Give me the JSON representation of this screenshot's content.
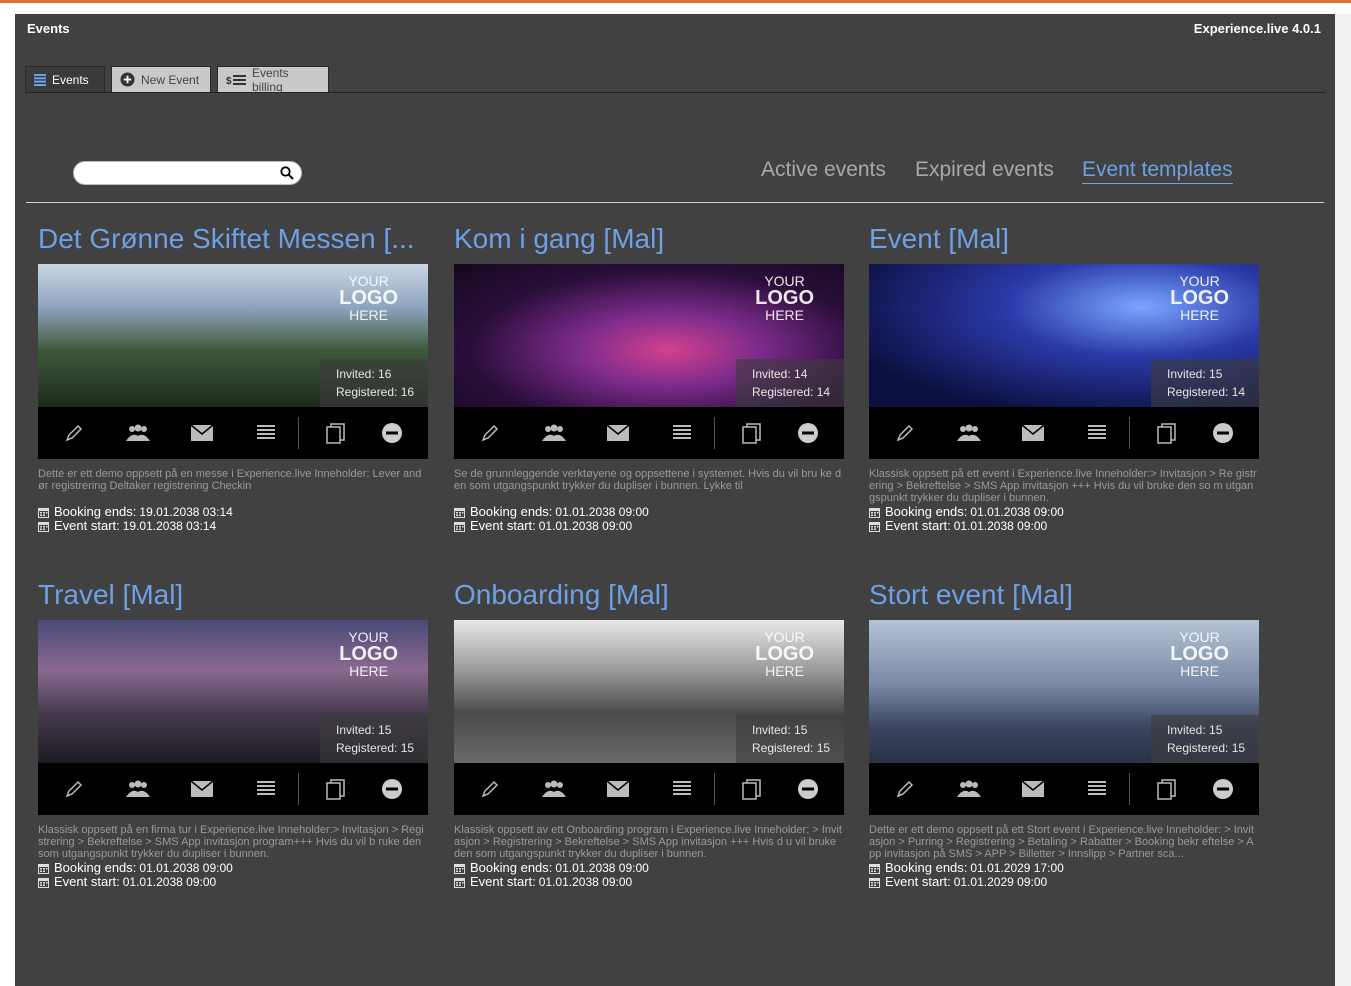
{
  "app": {
    "title": "Events",
    "version": "Experience.live 4.0.1"
  },
  "tabs": [
    {
      "label": "Events",
      "icon": "list-icon"
    },
    {
      "label": "New Event",
      "icon": "plus-circle-icon"
    },
    {
      "label": "Events billing",
      "icon": "billing-icon"
    }
  ],
  "search": {
    "placeholder": "",
    "value": ""
  },
  "filters": [
    {
      "label": "Active events",
      "active": false
    },
    {
      "label": "Expired events",
      "active": false
    },
    {
      "label": "Event templates",
      "active": true
    }
  ],
  "logo": {
    "line1": "YOUR",
    "line2": "LOGO",
    "line3": "HERE"
  },
  "labels": {
    "booking_ends": "Booking ends:",
    "event_start": "Event start:"
  },
  "events": [
    {
      "title": "Det Grønne Skiftet Messen [...",
      "invited": "Invited: 16",
      "registered": "Registered: 16",
      "description": "Dette er ett demo oppsett på en messe i Experience.live Inneholder: Lever andør registrering Deltaker registrering Checkin",
      "booking_ends": "19.01.2038 03:14",
      "event_start": "19.01.2038 03:14"
    },
    {
      "title": "Kom i gang [Mal]",
      "invited": "Invited: 14",
      "registered": "Registered: 14",
      "description": "Se de grunnleggende verktøyene og oppsettene i systemet. Hvis du vil bru ke den som utgangspunkt trykker du dupliser i bunnen. Lykke til",
      "booking_ends": "01.01.2038 09:00",
      "event_start": "01.01.2038 09:00"
    },
    {
      "title": "Event [Mal]",
      "invited": "Invited: 15",
      "registered": "Registered: 14",
      "description": "Klassisk oppsett på ett event i Experience.live Inneholder:> Invitasjon > Re gistrering > Bekreftelse > SMS App invitasjon +++ Hvis du vil bruke den so m utgangspunkt trykker du dupliser i bunnen.",
      "booking_ends": "01.01.2038 09:00",
      "event_start": "01.01.2038 09:00"
    },
    {
      "title": "Travel [Mal]",
      "invited": "Invited: 15",
      "registered": "Registered: 15",
      "description": "Klassisk oppsett på en firma tur i Experience.live Inneholder:> Invitasjon > Registrering > Bekreftelse > SMS App invitasjon program+++ Hvis du vil b ruke den som utgangspunkt trykker du dupliser i bunnen.",
      "booking_ends": "01.01.2038 09:00",
      "event_start": "01.01.2038 09:00"
    },
    {
      "title": "Onboarding [Mal]",
      "invited": "Invited: 15",
      "registered": "Registered: 15",
      "description": "Klassisk oppsett av ett Onboarding program i Experience.live Inneholder: > Invitasjon > Registrering > Bekreftelse > SMS App invitasjon +++ Hvis d u vil bruke den som utgangspunkt trykker du dupliser i bunnen.",
      "booking_ends": "01.01.2038 09:00",
      "event_start": "01.01.2038 09:00"
    },
    {
      "title": "Stort event [Mal]",
      "invited": "Invited: 15",
      "registered": "Registered: 15",
      "description": "Dette er ett demo oppsett på ett Stort event i Experience.live Inneholder: > Invitasjon > Purring > Registrering > Betaling > Rabatter > Booking bekr eftelse > App invitasjon på SMS > APP > Billetter > Innslipp > Partner sca...",
      "booking_ends": "01.01.2029 17:00",
      "event_start": "01.01.2029 09:00"
    }
  ],
  "colors": {
    "accent": "#6ea0e6",
    "background": "#414141",
    "top_line": "#e0703a"
  }
}
